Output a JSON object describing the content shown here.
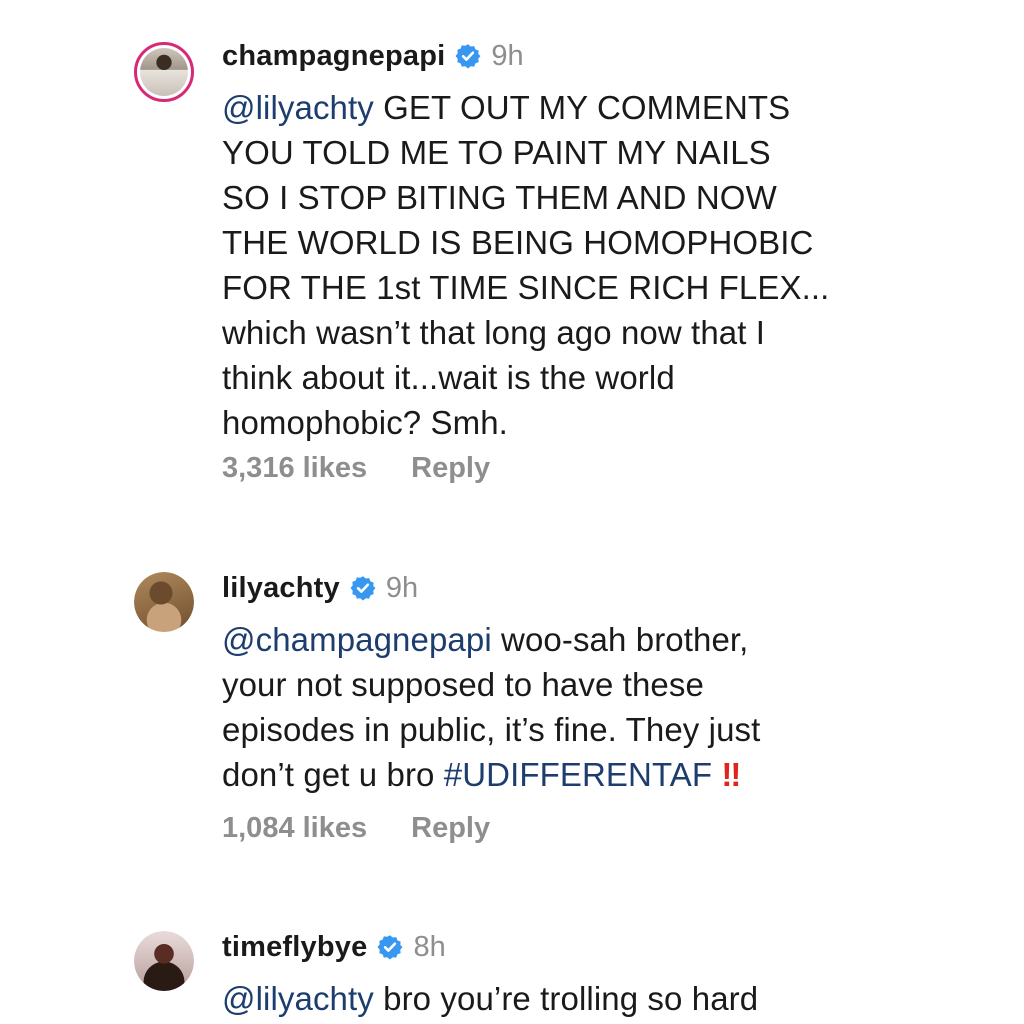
{
  "comments": [
    {
      "username": "champagnepapi",
      "time": "9h",
      "mention": "@lilyachty",
      "first_line_rest": " GET OUT MY COMMENTS",
      "lines": [
        "YOU TOLD ME TO PAINT MY NAILS",
        "SO I STOP BITING THEM AND NOW",
        "THE WORLD IS BEING HOMOPHOBIC",
        "FOR THE 1st TIME SINCE RICH FLEX...",
        "which wasn’t that long ago now that I",
        "think about it...wait is the world",
        "homophobic? Smh."
      ],
      "likes": "3,316 likes",
      "reply": "Reply"
    },
    {
      "username": "lilyachty",
      "time": "9h",
      "mention": "@champagnepapi",
      "first_line_rest": " woo-sah brother,",
      "lines": [
        "your not supposed to have these",
        "episodes in public, it’s fine. They just"
      ],
      "last_line_text": "don’t get u bro ",
      "hashtag": "#UDIFFERENTAF",
      "emoji": "‼",
      "likes": "1,084 likes",
      "reply": "Reply"
    },
    {
      "username": "timeflybye",
      "time": "8h",
      "mention": "@lilyachty",
      "first_line_rest": " bro you’re trolling so hard"
    }
  ],
  "colors": {
    "verified": "#3897f0",
    "mention": "#1c3d6e",
    "muted": "#8e8e8e",
    "emoji": "#e0241b"
  }
}
